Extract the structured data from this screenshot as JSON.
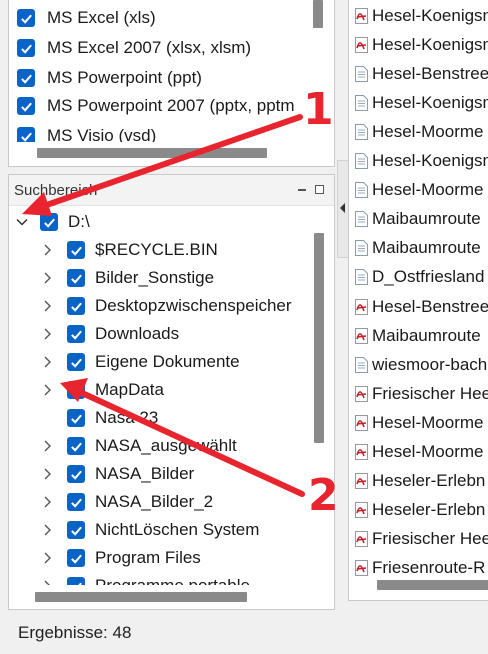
{
  "file_types": {
    "items": [
      {
        "label": "MS Excel (xls)",
        "checked": true
      },
      {
        "label": "MS Excel 2007 (xlsx, xlsm)",
        "checked": true
      },
      {
        "label": "MS Powerpoint (ppt)",
        "checked": true
      },
      {
        "label": "MS Powerpoint 2007 (pptx, pptm",
        "checked": true
      },
      {
        "label": "MS Visio (vsd)",
        "checked": true
      }
    ]
  },
  "search_area": {
    "title": "Suchbereich",
    "root": {
      "label": "D:\\",
      "checked": true,
      "expanded": true
    },
    "children": [
      {
        "label": "$RECYCLE.BIN",
        "checked": true,
        "expandable": true
      },
      {
        "label": "Bilder_Sonstige",
        "checked": true,
        "expandable": true
      },
      {
        "label": "Desktopzwischenspeicher",
        "checked": true,
        "expandable": true
      },
      {
        "label": "Downloads",
        "checked": true,
        "expandable": true
      },
      {
        "label": "Eigene Dokumente",
        "checked": true,
        "expandable": true
      },
      {
        "label": "MapData",
        "checked": true,
        "expandable": true
      },
      {
        "label": "Nasa 23",
        "checked": true,
        "expandable": false
      },
      {
        "label": "NASA_ausgewählt",
        "checked": true,
        "expandable": true
      },
      {
        "label": "NASA_Bilder",
        "checked": true,
        "expandable": true
      },
      {
        "label": "NASA_Bilder_2",
        "checked": true,
        "expandable": true
      },
      {
        "label": "NichtLöschen System",
        "checked": true,
        "expandable": true
      },
      {
        "label": "Program Files",
        "checked": true,
        "expandable": true
      },
      {
        "label": "Programme portable",
        "checked": true,
        "expandable": true
      }
    ]
  },
  "results": {
    "items": [
      {
        "label": "Hesel-Koenigsn",
        "icon": "pdf-file-icon"
      },
      {
        "label": "Hesel-Koenigsm",
        "icon": "pdf-file-icon"
      },
      {
        "label": "Hesel-Benstree",
        "icon": "text-file-icon"
      },
      {
        "label": "Hesel-Koenigsm",
        "icon": "text-file-icon"
      },
      {
        "label": "Hesel-Moorme",
        "icon": "text-file-icon"
      },
      {
        "label": "Hesel-Koenigsm",
        "icon": "text-file-icon"
      },
      {
        "label": "Hesel-Moorme",
        "icon": "text-file-icon"
      },
      {
        "label": "Maibaumroute",
        "icon": "text-file-icon"
      },
      {
        "label": "Maibaumroute",
        "icon": "text-file-icon"
      },
      {
        "label": "D_Ostfriesland",
        "icon": "text-file-icon"
      },
      {
        "label": "Hesel-Benstree",
        "icon": "pdf-file-icon"
      },
      {
        "label": "Maibaumroute",
        "icon": "pdf-file-icon"
      },
      {
        "label": "wiesmoor-bach",
        "icon": "text-file-icon"
      },
      {
        "label": "Friesischer Hee",
        "icon": "pdf-file-icon"
      },
      {
        "label": "Hesel-Moorme",
        "icon": "pdf-file-icon"
      },
      {
        "label": "Hesel-Moorme",
        "icon": "pdf-file-icon"
      },
      {
        "label": "Heseler-Erlebn",
        "icon": "pdf-file-icon"
      },
      {
        "label": "Heseler-Erlebn",
        "icon": "pdf-file-icon"
      },
      {
        "label": "Friesischer Hee",
        "icon": "pdf-file-icon"
      },
      {
        "label": "Friesenroute-R",
        "icon": "pdf-file-icon"
      }
    ]
  },
  "status": {
    "results_text": "Ergebnisse: 48"
  },
  "annotations": {
    "number_1": "1",
    "number_2": "2",
    "color": "#e8242e"
  },
  "colors": {
    "checkbox": "#0a64c8"
  }
}
